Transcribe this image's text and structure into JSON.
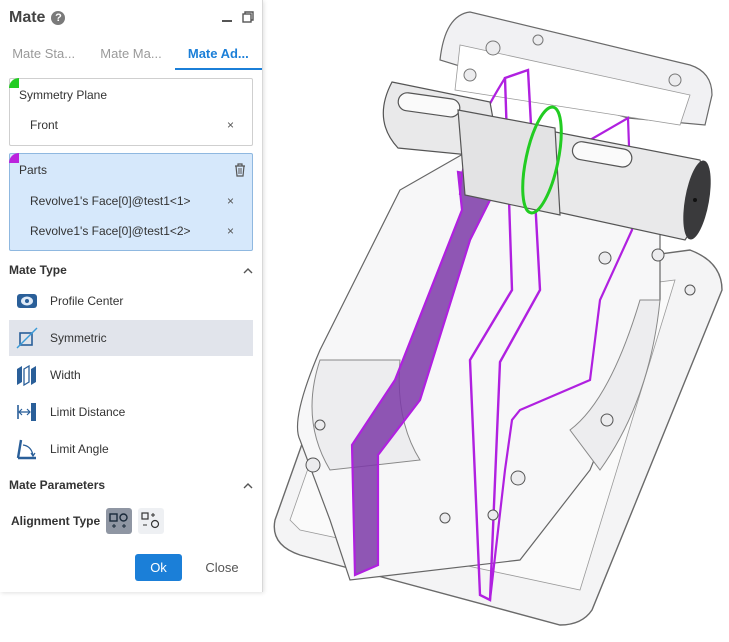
{
  "panel": {
    "title": "Mate",
    "tabs": [
      {
        "label": "Mate Sta..."
      },
      {
        "label": "Mate Ma..."
      },
      {
        "label": "Mate Ad..."
      }
    ],
    "symmetry_plane": {
      "label": "Symmetry Plane",
      "value": "Front",
      "marker_color": "#22cc22"
    },
    "parts": {
      "label": "Parts",
      "items": [
        "Revolve1's Face[0]@test1<1>",
        "Revolve1's Face[0]@test1<2>"
      ],
      "marker_color": "#bb22dd"
    },
    "mate_type": {
      "heading": "Mate Type",
      "items": [
        {
          "label": "Profile Center",
          "icon": "profile-center-icon"
        },
        {
          "label": "Symmetric",
          "icon": "symmetric-icon",
          "selected": true
        },
        {
          "label": "Width",
          "icon": "width-icon"
        },
        {
          "label": "Limit Distance",
          "icon": "limit-distance-icon"
        },
        {
          "label": "Limit Angle",
          "icon": "limit-angle-icon"
        }
      ]
    },
    "mate_parameters": {
      "heading": "Mate Parameters",
      "alignment_label": "Alignment Type"
    },
    "buttons": {
      "ok": "Ok",
      "close": "Close"
    }
  },
  "colors": {
    "accent": "#1b7fd8",
    "selection_purple": "#b020e0",
    "selection_green": "#22cc22",
    "parts_bg": "#d6e8fb"
  }
}
